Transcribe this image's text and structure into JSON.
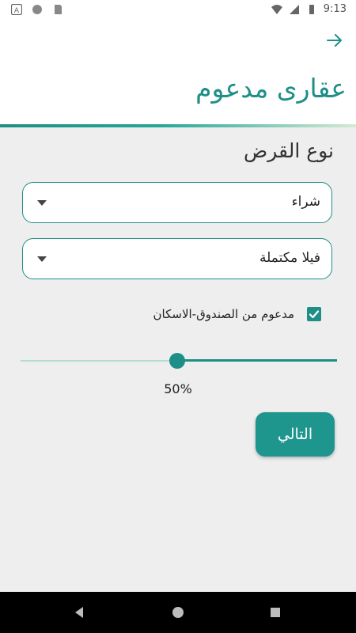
{
  "status_bar": {
    "time": "9:13",
    "icons": [
      "a-icon",
      "circle-icon",
      "sd-card-icon",
      "wifi-icon",
      "signal-icon",
      "battery-icon"
    ]
  },
  "header": {
    "title": "عقارى مدعوم",
    "back_icon": "arrow-right-icon"
  },
  "form": {
    "section_title": "نوع القرض",
    "loan_type": {
      "selected": "شراء"
    },
    "property_type": {
      "selected": "فيلا مكتملة"
    },
    "supported_checkbox": {
      "label": "مدعوم من الصندوق-الاسكان",
      "checked": true
    },
    "slider": {
      "value_percent": 50,
      "label": "50%"
    },
    "next_label": "التالي"
  },
  "nav_bar": {
    "icons": [
      "back-triangle-icon",
      "home-circle-icon",
      "recents-square-icon"
    ]
  },
  "colors": {
    "accent": "#1e8f87",
    "background": "#eeeeee",
    "header_bg": "#ffffff"
  }
}
